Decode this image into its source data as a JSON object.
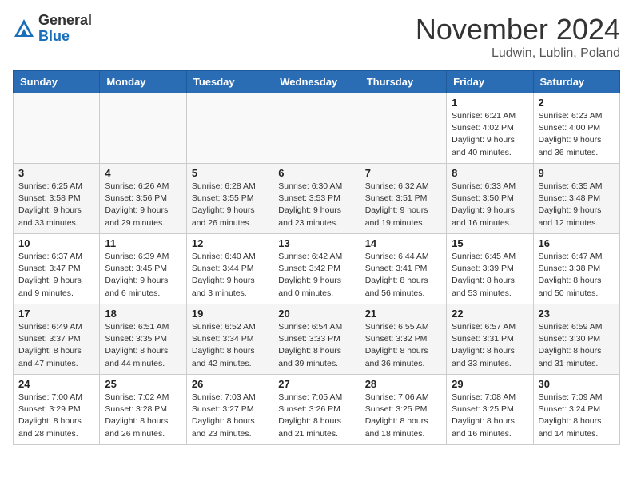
{
  "header": {
    "logo_general": "General",
    "logo_blue": "Blue",
    "month_title": "November 2024",
    "location": "Ludwin, Lublin, Poland"
  },
  "days_of_week": [
    "Sunday",
    "Monday",
    "Tuesday",
    "Wednesday",
    "Thursday",
    "Friday",
    "Saturday"
  ],
  "weeks": [
    [
      {
        "day": "",
        "info": ""
      },
      {
        "day": "",
        "info": ""
      },
      {
        "day": "",
        "info": ""
      },
      {
        "day": "",
        "info": ""
      },
      {
        "day": "",
        "info": ""
      },
      {
        "day": "1",
        "info": "Sunrise: 6:21 AM\nSunset: 4:02 PM\nDaylight: 9 hours\nand 40 minutes."
      },
      {
        "day": "2",
        "info": "Sunrise: 6:23 AM\nSunset: 4:00 PM\nDaylight: 9 hours\nand 36 minutes."
      }
    ],
    [
      {
        "day": "3",
        "info": "Sunrise: 6:25 AM\nSunset: 3:58 PM\nDaylight: 9 hours\nand 33 minutes."
      },
      {
        "day": "4",
        "info": "Sunrise: 6:26 AM\nSunset: 3:56 PM\nDaylight: 9 hours\nand 29 minutes."
      },
      {
        "day": "5",
        "info": "Sunrise: 6:28 AM\nSunset: 3:55 PM\nDaylight: 9 hours\nand 26 minutes."
      },
      {
        "day": "6",
        "info": "Sunrise: 6:30 AM\nSunset: 3:53 PM\nDaylight: 9 hours\nand 23 minutes."
      },
      {
        "day": "7",
        "info": "Sunrise: 6:32 AM\nSunset: 3:51 PM\nDaylight: 9 hours\nand 19 minutes."
      },
      {
        "day": "8",
        "info": "Sunrise: 6:33 AM\nSunset: 3:50 PM\nDaylight: 9 hours\nand 16 minutes."
      },
      {
        "day": "9",
        "info": "Sunrise: 6:35 AM\nSunset: 3:48 PM\nDaylight: 9 hours\nand 12 minutes."
      }
    ],
    [
      {
        "day": "10",
        "info": "Sunrise: 6:37 AM\nSunset: 3:47 PM\nDaylight: 9 hours\nand 9 minutes."
      },
      {
        "day": "11",
        "info": "Sunrise: 6:39 AM\nSunset: 3:45 PM\nDaylight: 9 hours\nand 6 minutes."
      },
      {
        "day": "12",
        "info": "Sunrise: 6:40 AM\nSunset: 3:44 PM\nDaylight: 9 hours\nand 3 minutes."
      },
      {
        "day": "13",
        "info": "Sunrise: 6:42 AM\nSunset: 3:42 PM\nDaylight: 9 hours\nand 0 minutes."
      },
      {
        "day": "14",
        "info": "Sunrise: 6:44 AM\nSunset: 3:41 PM\nDaylight: 8 hours\nand 56 minutes."
      },
      {
        "day": "15",
        "info": "Sunrise: 6:45 AM\nSunset: 3:39 PM\nDaylight: 8 hours\nand 53 minutes."
      },
      {
        "day": "16",
        "info": "Sunrise: 6:47 AM\nSunset: 3:38 PM\nDaylight: 8 hours\nand 50 minutes."
      }
    ],
    [
      {
        "day": "17",
        "info": "Sunrise: 6:49 AM\nSunset: 3:37 PM\nDaylight: 8 hours\nand 47 minutes."
      },
      {
        "day": "18",
        "info": "Sunrise: 6:51 AM\nSunset: 3:35 PM\nDaylight: 8 hours\nand 44 minutes."
      },
      {
        "day": "19",
        "info": "Sunrise: 6:52 AM\nSunset: 3:34 PM\nDaylight: 8 hours\nand 42 minutes."
      },
      {
        "day": "20",
        "info": "Sunrise: 6:54 AM\nSunset: 3:33 PM\nDaylight: 8 hours\nand 39 minutes."
      },
      {
        "day": "21",
        "info": "Sunrise: 6:55 AM\nSunset: 3:32 PM\nDaylight: 8 hours\nand 36 minutes."
      },
      {
        "day": "22",
        "info": "Sunrise: 6:57 AM\nSunset: 3:31 PM\nDaylight: 8 hours\nand 33 minutes."
      },
      {
        "day": "23",
        "info": "Sunrise: 6:59 AM\nSunset: 3:30 PM\nDaylight: 8 hours\nand 31 minutes."
      }
    ],
    [
      {
        "day": "24",
        "info": "Sunrise: 7:00 AM\nSunset: 3:29 PM\nDaylight: 8 hours\nand 28 minutes."
      },
      {
        "day": "25",
        "info": "Sunrise: 7:02 AM\nSunset: 3:28 PM\nDaylight: 8 hours\nand 26 minutes."
      },
      {
        "day": "26",
        "info": "Sunrise: 7:03 AM\nSunset: 3:27 PM\nDaylight: 8 hours\nand 23 minutes."
      },
      {
        "day": "27",
        "info": "Sunrise: 7:05 AM\nSunset: 3:26 PM\nDaylight: 8 hours\nand 21 minutes."
      },
      {
        "day": "28",
        "info": "Sunrise: 7:06 AM\nSunset: 3:25 PM\nDaylight: 8 hours\nand 18 minutes."
      },
      {
        "day": "29",
        "info": "Sunrise: 7:08 AM\nSunset: 3:25 PM\nDaylight: 8 hours\nand 16 minutes."
      },
      {
        "day": "30",
        "info": "Sunrise: 7:09 AM\nSunset: 3:24 PM\nDaylight: 8 hours\nand 14 minutes."
      }
    ]
  ]
}
